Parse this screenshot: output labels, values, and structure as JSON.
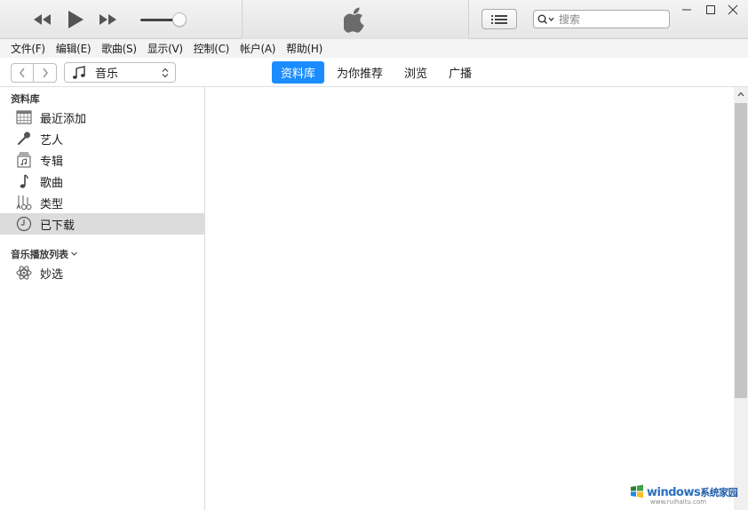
{
  "player": {
    "controls": [
      {
        "name": "previous-button",
        "icon": "rewind-icon"
      },
      {
        "name": "play-button",
        "icon": "play-icon"
      },
      {
        "name": "next-button",
        "icon": "fast-forward-icon"
      }
    ],
    "volume_level": 0.7,
    "lcd_icon": "apple-logo-icon"
  },
  "search": {
    "placeholder": "搜索"
  },
  "menubar": {
    "items": [
      "文件(F)",
      "编辑(E)",
      "歌曲(S)",
      "显示(V)",
      "控制(C)",
      "帐户(A)",
      "帮助(H)"
    ]
  },
  "nav": {
    "media_selector": "音乐",
    "tabs": [
      "资料库",
      "为你推荐",
      "浏览",
      "广播"
    ],
    "active_tab": "资料库"
  },
  "sidebar": {
    "library_header": "资料库",
    "library_items": [
      {
        "label": "最近添加",
        "icon": "grid-calendar-icon"
      },
      {
        "label": "艺人",
        "icon": "microphone-icon"
      },
      {
        "label": "专辑",
        "icon": "album-icon"
      },
      {
        "label": "歌曲",
        "icon": "music-note-icon"
      },
      {
        "label": "类型",
        "icon": "genre-icon"
      },
      {
        "label": "已下载",
        "icon": "download-clock-icon",
        "selected": true
      }
    ],
    "playlists_header": "音乐播放列表",
    "playlist_items": [
      {
        "label": "妙选",
        "icon": "atom-icon"
      }
    ]
  },
  "watermark": {
    "main": "windows",
    "sub": "系统家园",
    "url": "www.ruihaitu.com"
  },
  "colors": {
    "accent": "#1a8cff",
    "selected_row": "#dcdcdc",
    "scroll_thumb": "#c4c4c4"
  }
}
